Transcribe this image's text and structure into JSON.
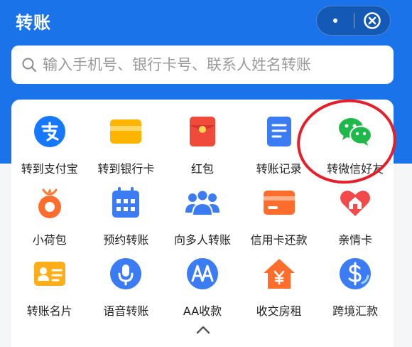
{
  "header": {
    "title": "转账",
    "colors": {
      "primary": "#1a73e8",
      "highlight_ring": "#e61e2a"
    }
  },
  "capsule": {
    "more_icon": "more-dots-icon",
    "close_icon": "close-circle-icon"
  },
  "search": {
    "placeholder": "输入手机号、银行卡号、联系人姓名转账",
    "value": ""
  },
  "grid": {
    "rows": [
      [
        {
          "label": "转到支付宝",
          "icon": "alipay-icon"
        },
        {
          "label": "转到银行卡",
          "icon": "bank-card-icon"
        },
        {
          "label": "红包",
          "icon": "red-envelope-icon"
        },
        {
          "label": "转账记录",
          "icon": "document-icon"
        },
        {
          "label": "转微信好友",
          "icon": "wechat-icon"
        }
      ],
      [
        {
          "label": "小荷包",
          "icon": "pouch-icon"
        },
        {
          "label": "预约转账",
          "icon": "calendar-icon"
        },
        {
          "label": "向多人转账",
          "icon": "people-icon"
        },
        {
          "label": "信用卡还款",
          "icon": "credit-card-icon"
        },
        {
          "label": "亲情卡",
          "icon": "family-card-icon"
        }
      ],
      [
        {
          "label": "转账名片",
          "icon": "id-card-icon"
        },
        {
          "label": "语音转账",
          "icon": "microphone-icon"
        },
        {
          "label": "AA收款",
          "icon": "aa-icon"
        },
        {
          "label": "收交房租",
          "icon": "house-rent-icon"
        },
        {
          "label": "跨境汇款",
          "icon": "cross-border-icon"
        }
      ]
    ]
  },
  "footer": {
    "collapse_icon": "chevron-up-icon"
  }
}
